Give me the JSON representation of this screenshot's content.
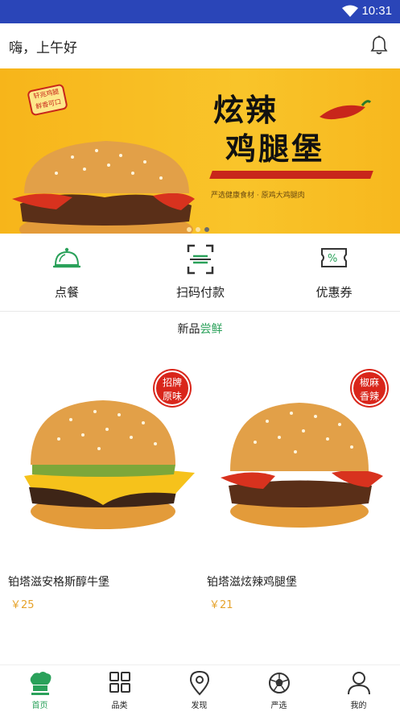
{
  "status_bar": {
    "time": "10:31"
  },
  "header": {
    "greeting": "嗨，上午好",
    "icons": [
      "bell-icon"
    ]
  },
  "banner": {
    "tag": "轩兆鸡腿 鲜香可口",
    "title_line1": "炫辣",
    "title_line2": "鸡腿堡",
    "description": "严选健康食材 · 原鸡大鸡腿肉",
    "active_slide": 3,
    "slide_count": 3,
    "colors": {
      "background": "#f9c42a",
      "accent": "#c8261b"
    }
  },
  "quick_actions": [
    {
      "label": "点餐",
      "icon": "food-cloche-icon"
    },
    {
      "label": "扫码付款",
      "icon": "scan-icon"
    },
    {
      "label": "优惠券",
      "icon": "coupon-icon"
    }
  ],
  "section": {
    "title_prefix": "新品",
    "title_accent": "尝鲜"
  },
  "products": [
    {
      "badge_line1": "招牌",
      "badge_line2": "原味",
      "name": "铂塔滋安格斯醇牛堡",
      "price": "￥25"
    },
    {
      "badge_line1": "椒麻",
      "badge_line2": "香辣",
      "name": "铂塔滋炫辣鸡腿堡",
      "price": "￥21"
    }
  ],
  "tabs": [
    {
      "label": "首页",
      "icon": "chef-hat-icon",
      "active": true
    },
    {
      "label": "品类",
      "icon": "grid-icon",
      "active": false
    },
    {
      "label": "发现",
      "icon": "location-pin-icon",
      "active": false
    },
    {
      "label": "严选",
      "icon": "football-icon",
      "active": false
    },
    {
      "label": "我的",
      "icon": "user-icon",
      "active": false
    }
  ],
  "colors": {
    "status_bar": "#2a45b8",
    "accent_green": "#2aa15a",
    "price": "#e6a22a",
    "badge_red": "#d9261b"
  }
}
